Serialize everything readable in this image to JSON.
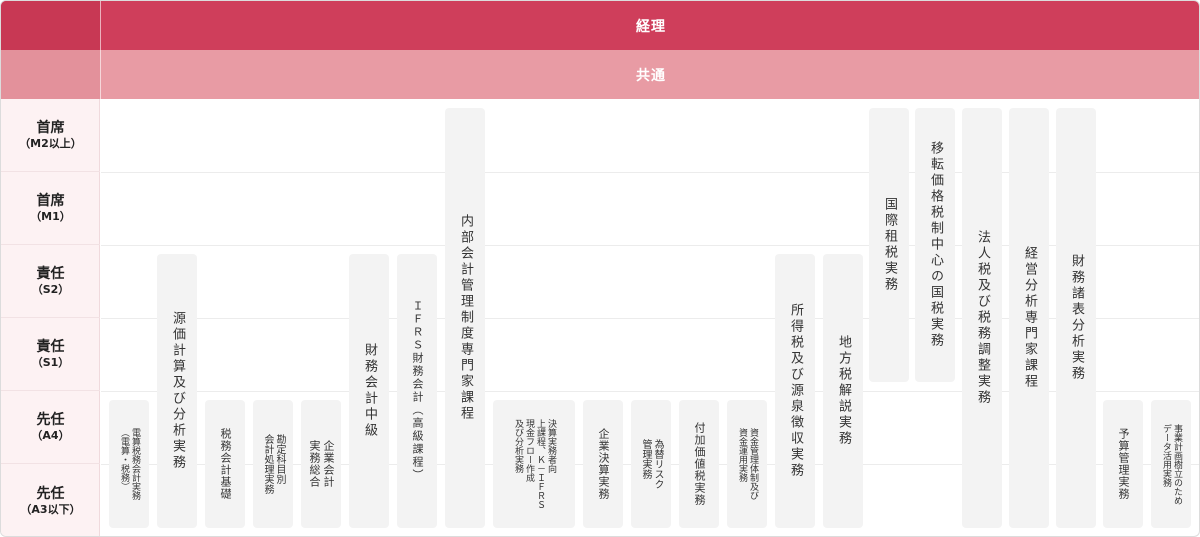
{
  "header": {
    "department": "経理",
    "common": "共通"
  },
  "levels": [
    {
      "title": "首席",
      "code": "（M2以上）"
    },
    {
      "title": "首席",
      "code": "（M1）"
    },
    {
      "title": "責任",
      "code": "（S2）"
    },
    {
      "title": "責任",
      "code": "（S1）"
    },
    {
      "title": "先任",
      "code": "（A4）"
    },
    {
      "title": "先任",
      "code": "（A3以下）"
    }
  ],
  "courses": {
    "c01": "電算税務会計実務\n（電算・税務）",
    "c02": "源価計算及び分析実務",
    "c03": "税務会計基礎",
    "c04": "勘定科目別\n会計処理実務",
    "c05": "企業会計\n実務総合",
    "c06": "財務会計中級",
    "c07": "ＩＦＲＳ財務会計（高級課程）",
    "c08": "内部会計管理制度専門家課程",
    "c09": "決算実務者向\n上課程、Ｋ－ＩＦＲＳ\n現金フロー作成\n及び分析実務",
    "c10": "企業決算実務",
    "c11": "為替リスク\n管理実務",
    "c12": "付加価値税実務",
    "c13": "資金管理体制及び\n資金運用実務",
    "c14": "所得税及び源泉徴収実務",
    "c15": "地方税解説実務",
    "c16": "国際租税実務",
    "c17": "移転価格税制中心の国税実務",
    "c18": "法人税及び税務調整実務",
    "c19": "経営分析専門家課程",
    "c20": "財務諸表分析実務",
    "c21": "予算管理実務",
    "c22": "事業計画樹立のため\nデータ活用実務"
  }
}
